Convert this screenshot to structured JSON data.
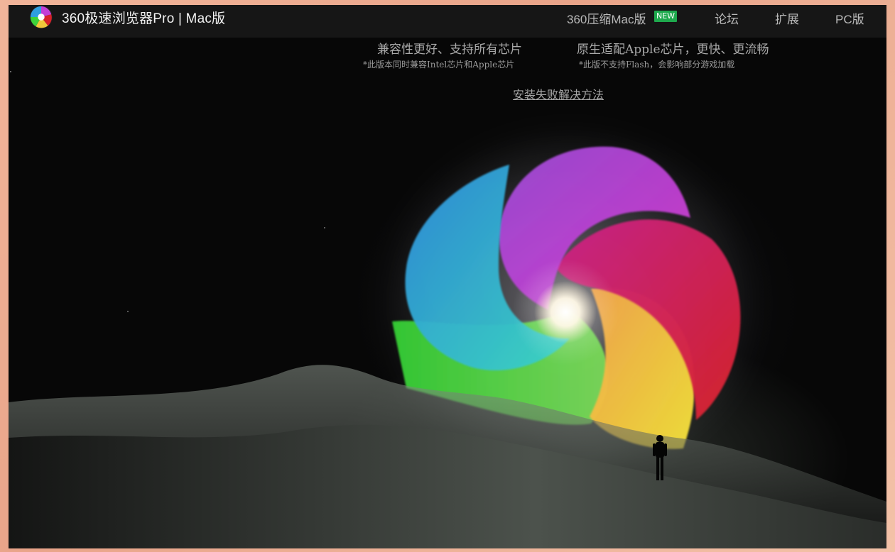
{
  "header": {
    "brand": "360极速浏览器Pro | Mac版",
    "nav": [
      {
        "label": "360压缩Mac版",
        "badge": "NEW"
      },
      {
        "label": "论坛"
      },
      {
        "label": "扩展"
      },
      {
        "label": "PC版"
      }
    ]
  },
  "versions": [
    {
      "title": "兼容性更好、支持所有芯片",
      "note": "*此版本同时兼容Intel芯片和Apple芯片"
    },
    {
      "title": "原生适配Apple芯片，更快、更流畅",
      "note": "*此版不支持Flash，会影响部分游戏加载"
    }
  ],
  "help_link": "安装失败解决方法",
  "hero": {
    "logo_colors": [
      "#2f9fe0",
      "#c23fd8",
      "#d8222a",
      "#f0c83a",
      "#3dd23a"
    ]
  },
  "colors": {
    "badge": "#1ea94d",
    "page_bg": "#0b0b0b",
    "outer_bg": "#f1b59a"
  }
}
